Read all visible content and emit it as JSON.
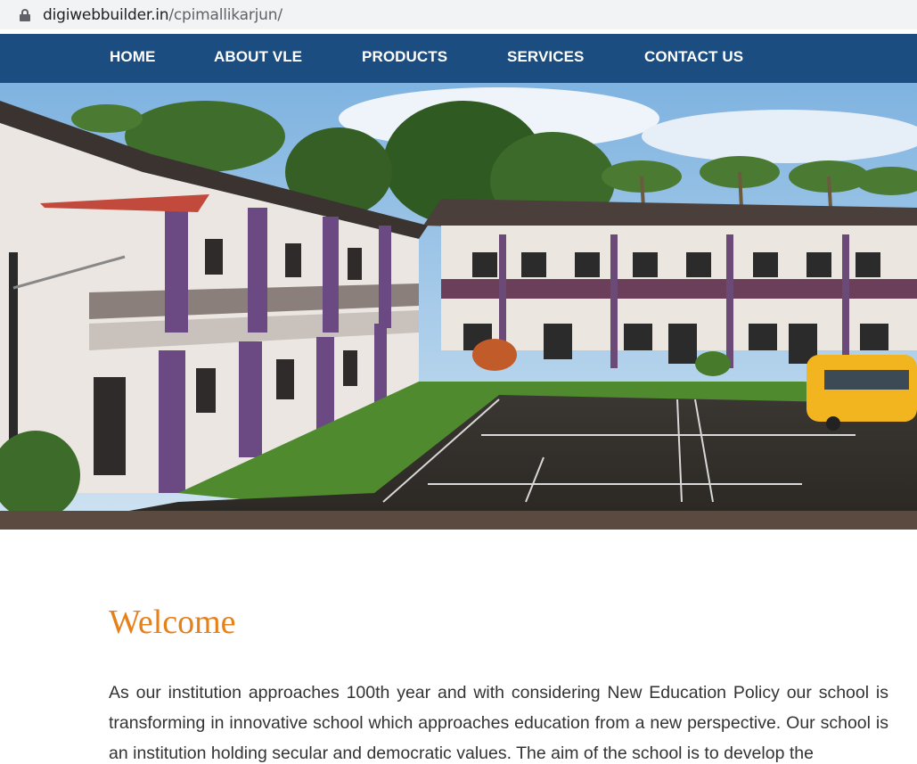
{
  "browser": {
    "url_domain": "digiwebbuilder.in",
    "url_path": "/cpimallikarjun/"
  },
  "nav": {
    "items": [
      {
        "label": "HOME"
      },
      {
        "label": "ABOUT VLE"
      },
      {
        "label": "PRODUCTS"
      },
      {
        "label": "SERVICES"
      },
      {
        "label": "CONTACT US"
      }
    ]
  },
  "hero": {
    "slide_count": 3,
    "active_slide": 2
  },
  "content": {
    "heading": "Welcome",
    "paragraph": "As our institution approaches 100th year and with considering New Education Policy our school is transforming in innovative school which approaches education from a new perspective. Our school is an institution holding secular and democratic values. The aim of the school is to develop the"
  },
  "colors": {
    "nav_bg": "#1b4d80",
    "heading": "#e8801a"
  }
}
